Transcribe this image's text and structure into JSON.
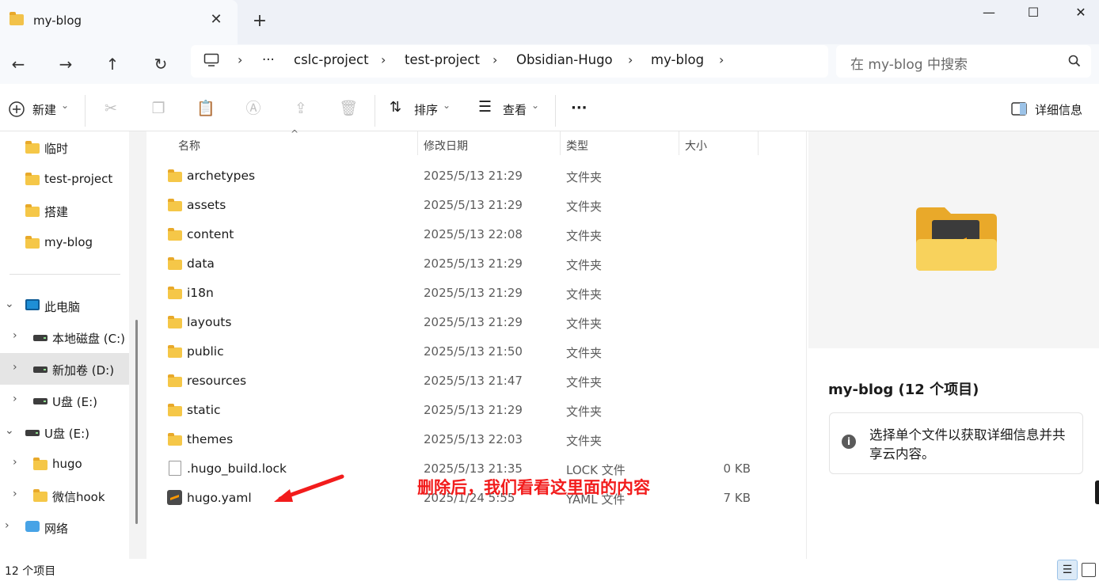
{
  "window": {
    "tab_title": "my-blog",
    "close_glyph": "✕",
    "new_tab_glyph": "+",
    "minimize_glyph": "—",
    "maximize_glyph": "☐",
    "window_close_glyph": "✕"
  },
  "nav": {
    "back": "←",
    "forward": "→",
    "up": "↑",
    "refresh": "↻"
  },
  "breadcrumb": {
    "more": "···",
    "separator": "›",
    "items": [
      "cslc-project",
      "test-project",
      "Obsidian-Hugo",
      "my-blog"
    ]
  },
  "search": {
    "placeholder": "在 my-blog 中搜索"
  },
  "toolbar": {
    "new_label": "新建",
    "sort_label": "排序",
    "view_label": "查看",
    "more_glyph": "···",
    "details_label": "详细信息",
    "dropdown_glyph": "⌄"
  },
  "sidebar": {
    "quick": [
      {
        "label": "临时"
      },
      {
        "label": "test-project"
      },
      {
        "label": "搭建"
      },
      {
        "label": "my-blog"
      }
    ],
    "this_pc": "此电脑",
    "drives_pc": [
      {
        "label": "本地磁盘 (C:)"
      },
      {
        "label": "新加卷 (D:)"
      },
      {
        "label": "U盘 (E:)"
      }
    ],
    "usb": "U盘 (E:)",
    "usb_children": [
      {
        "label": "hugo"
      },
      {
        "label": "微信hook"
      }
    ],
    "network": "网络",
    "expand_glyph": "›",
    "collapse_glyph": "⌄"
  },
  "columns": {
    "name": "名称",
    "modified": "修改日期",
    "type": "类型",
    "size": "大小",
    "sort_glyph": "^"
  },
  "files": [
    {
      "name": "archetypes",
      "modified": "2025/5/13 21:29",
      "type": "文件夹",
      "size": "",
      "icon": "folder-icon"
    },
    {
      "name": "assets",
      "modified": "2025/5/13 21:29",
      "type": "文件夹",
      "size": "",
      "icon": "folder-icon"
    },
    {
      "name": "content",
      "modified": "2025/5/13 22:08",
      "type": "文件夹",
      "size": "",
      "icon": "folder-icon"
    },
    {
      "name": "data",
      "modified": "2025/5/13 21:29",
      "type": "文件夹",
      "size": "",
      "icon": "folder-icon"
    },
    {
      "name": "i18n",
      "modified": "2025/5/13 21:29",
      "type": "文件夹",
      "size": "",
      "icon": "folder-icon"
    },
    {
      "name": "layouts",
      "modified": "2025/5/13 21:29",
      "type": "文件夹",
      "size": "",
      "icon": "folder-icon"
    },
    {
      "name": "public",
      "modified": "2025/5/13 21:50",
      "type": "文件夹",
      "size": "",
      "icon": "folder-icon"
    },
    {
      "name": "resources",
      "modified": "2025/5/13 21:47",
      "type": "文件夹",
      "size": "",
      "icon": "folder-icon"
    },
    {
      "name": "static",
      "modified": "2025/5/13 21:29",
      "type": "文件夹",
      "size": "",
      "icon": "folder-icon"
    },
    {
      "name": "themes",
      "modified": "2025/5/13 22:03",
      "type": "文件夹",
      "size": "",
      "icon": "folder-icon"
    },
    {
      "name": ".hugo_build.lock",
      "modified": "2025/5/13 21:35",
      "type": "LOCK 文件",
      "size": "0 KB",
      "icon": "file-icon"
    },
    {
      "name": "hugo.yaml",
      "modified": "2025/1/24 5:55",
      "type": "YAML 文件",
      "size": "7 KB",
      "icon": "sublime-file-icon"
    }
  ],
  "details": {
    "title": "my-blog (12 个项目)",
    "info_glyph": "i",
    "info_text": "选择单个文件以获取详细信息并共享云内容。"
  },
  "annotation": {
    "text": "删除后，我们看看这里面的内容",
    "color": "#f21c1c"
  },
  "status": {
    "count": "12 个项目"
  },
  "colors": {
    "folder": "#f5c748",
    "selection": "#e5e5e5",
    "accent": "#1e8fd6"
  }
}
